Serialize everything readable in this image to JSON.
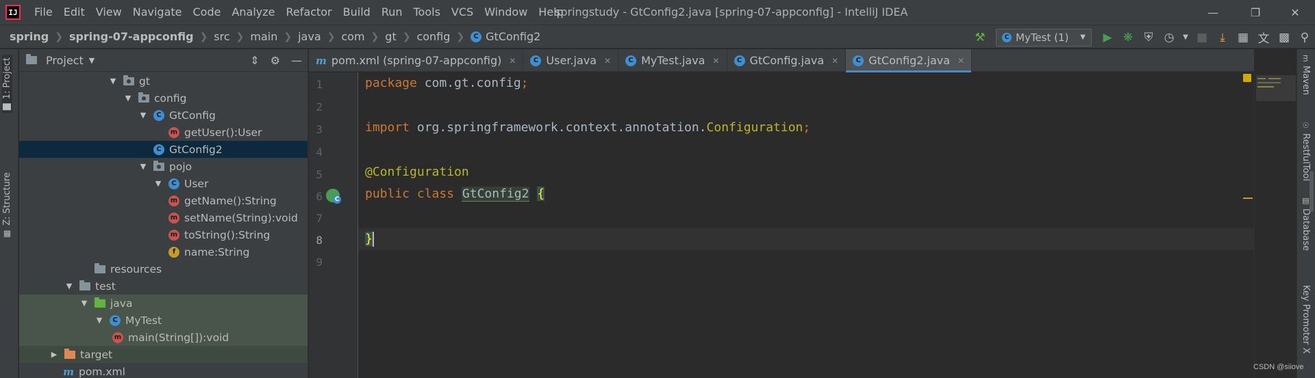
{
  "window": {
    "title": "springstudy - GtConfig2.java [spring-07-appconfig] - IntelliJ IDEA",
    "logo": "IJ"
  },
  "menu": [
    {
      "label": "File"
    },
    {
      "label": "Edit"
    },
    {
      "label": "View"
    },
    {
      "label": "Navigate"
    },
    {
      "label": "Code"
    },
    {
      "label": "Analyze"
    },
    {
      "label": "Refactor"
    },
    {
      "label": "Build"
    },
    {
      "label": "Run"
    },
    {
      "label": "Tools"
    },
    {
      "label": "VCS"
    },
    {
      "label": "Window"
    },
    {
      "label": "Help"
    }
  ],
  "breadcrumb": [
    "spring",
    "spring-07-appconfig",
    "src",
    "main",
    "java",
    "com",
    "gt",
    "config",
    "GtConfig2"
  ],
  "toolbar": {
    "run_config": "MyTest (1)"
  },
  "left_strip": {
    "project_tab": "1: Project",
    "structure_tab": "Z: Structure"
  },
  "project_panel": {
    "title": "Project"
  },
  "tree": [
    {
      "label": "gt",
      "type": "package",
      "expanded": true
    },
    {
      "label": "config",
      "type": "package",
      "expanded": true
    },
    {
      "label": "GtConfig",
      "type": "class",
      "expanded": true
    },
    {
      "label": "getUser():User",
      "type": "method"
    },
    {
      "label": "GtConfig2",
      "type": "class",
      "selected": true
    },
    {
      "label": "pojo",
      "type": "package",
      "expanded": true
    },
    {
      "label": "User",
      "type": "class",
      "expanded": true
    },
    {
      "label": "getName():String",
      "type": "method"
    },
    {
      "label": "setName(String):void",
      "type": "method"
    },
    {
      "label": "toString():String",
      "type": "method"
    },
    {
      "label": "name:String",
      "type": "field"
    },
    {
      "label": "resources",
      "type": "resources"
    },
    {
      "label": "test",
      "type": "folder",
      "expanded": true
    },
    {
      "label": "java",
      "type": "test-source",
      "expanded": true
    },
    {
      "label": "MyTest",
      "type": "test-class",
      "expanded": true
    },
    {
      "label": "main(String[]):void",
      "type": "method"
    },
    {
      "label": "target",
      "type": "excluded",
      "expanded": false
    },
    {
      "label": "pom.xml",
      "type": "xml"
    }
  ],
  "tabs": [
    {
      "label": "pom.xml (spring-07-appconfig)",
      "icon": "maven-icon"
    },
    {
      "label": "User.java",
      "icon": "class-icon"
    },
    {
      "label": "MyTest.java",
      "icon": "test-class-icon"
    },
    {
      "label": "GtConfig.java",
      "icon": "class-icon"
    },
    {
      "label": "GtConfig2.java",
      "icon": "class-icon",
      "active": true
    }
  ],
  "editor": {
    "current_line": 8,
    "lines": [
      {
        "n": "1"
      },
      {
        "n": "2"
      },
      {
        "n": "3"
      },
      {
        "n": "4"
      },
      {
        "n": "5"
      },
      {
        "n": "6"
      },
      {
        "n": "7"
      },
      {
        "n": "8"
      },
      {
        "n": "9"
      }
    ],
    "code": {
      "l1_kw": "package",
      "l1_rest": " com.gt.config",
      "l1_semi": ";",
      "l3_kw": "import",
      "l3_pkg": " org.springframework.context.annotation.",
      "l3_cls": "Configuration",
      "l3_semi": ";",
      "l5_ann": "@Configuration",
      "l6_kw": "public class ",
      "l6_cls": "GtConfig2",
      "l6_brace": "{",
      "l8_brace": "}"
    }
  },
  "right_strip": {
    "maven": "Maven",
    "restful": "RestfulTool",
    "database": "Database",
    "keypromoter": "Key Promoter X"
  },
  "watermark": "CSDN @siiove",
  "colors": {
    "keyword": "#cc7832",
    "annotation": "#bbb529",
    "text": "#a9b7c6",
    "selection": "#0d293e",
    "accent": "#4a88c7"
  }
}
